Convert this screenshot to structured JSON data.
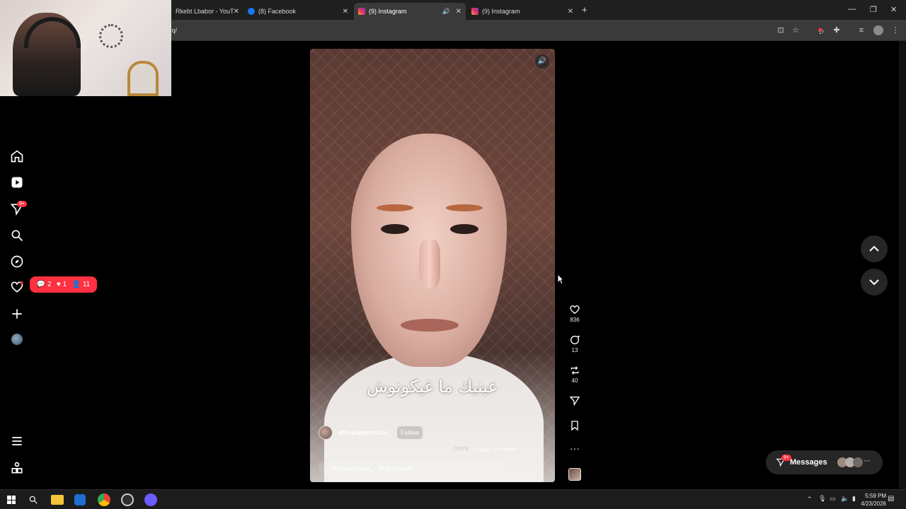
{
  "browser": {
    "tabs": [
      {
        "title": "Rkebt Lbabor - YouT",
        "icon": "youtube-icon",
        "color": "#ff0000",
        "active": false
      },
      {
        "title": "(8) Facebook",
        "icon": "facebook-icon",
        "color": "#1877f2",
        "active": false
      },
      {
        "title": "(9) Instagram",
        "icon": "instagram-icon",
        "color": "#e1306c",
        "active": true
      },
      {
        "title": "(9) Instagram",
        "icon": "instagram-icon",
        "color": "#e1306c",
        "active": false
      }
    ],
    "new_tab": "+",
    "url": "l.q/",
    "extension_badge": "17"
  },
  "leftnav": {
    "items": [
      {
        "name": "home-icon"
      },
      {
        "name": "reels-icon"
      },
      {
        "name": "messages-icon",
        "badge": "9+"
      },
      {
        "name": "search-icon"
      },
      {
        "name": "explore-icon"
      },
      {
        "name": "notifications-icon"
      },
      {
        "name": "create-icon"
      },
      {
        "name": "profile-icon"
      }
    ],
    "bottom": [
      {
        "name": "menu-icon"
      },
      {
        "name": "also-from-meta-icon"
      }
    ]
  },
  "notifications": {
    "comments": "2",
    "likes": "1",
    "followers": "11"
  },
  "reel": {
    "caption": "عينيك ما غيكونوش",
    "author": "xthesupernovax_",
    "follow_label": "Follow",
    "description": "قصة حب مؤثرة...",
    "more_label": "more",
    "audio": "xthesupernovax_ · Original audio"
  },
  "actions": {
    "likes": "836",
    "comments": "13",
    "reposts": "40"
  },
  "messages": {
    "label": "Messages",
    "badge": "9+"
  },
  "taskbar": {
    "time": "5:59 PM",
    "date": "4/23/2026"
  }
}
